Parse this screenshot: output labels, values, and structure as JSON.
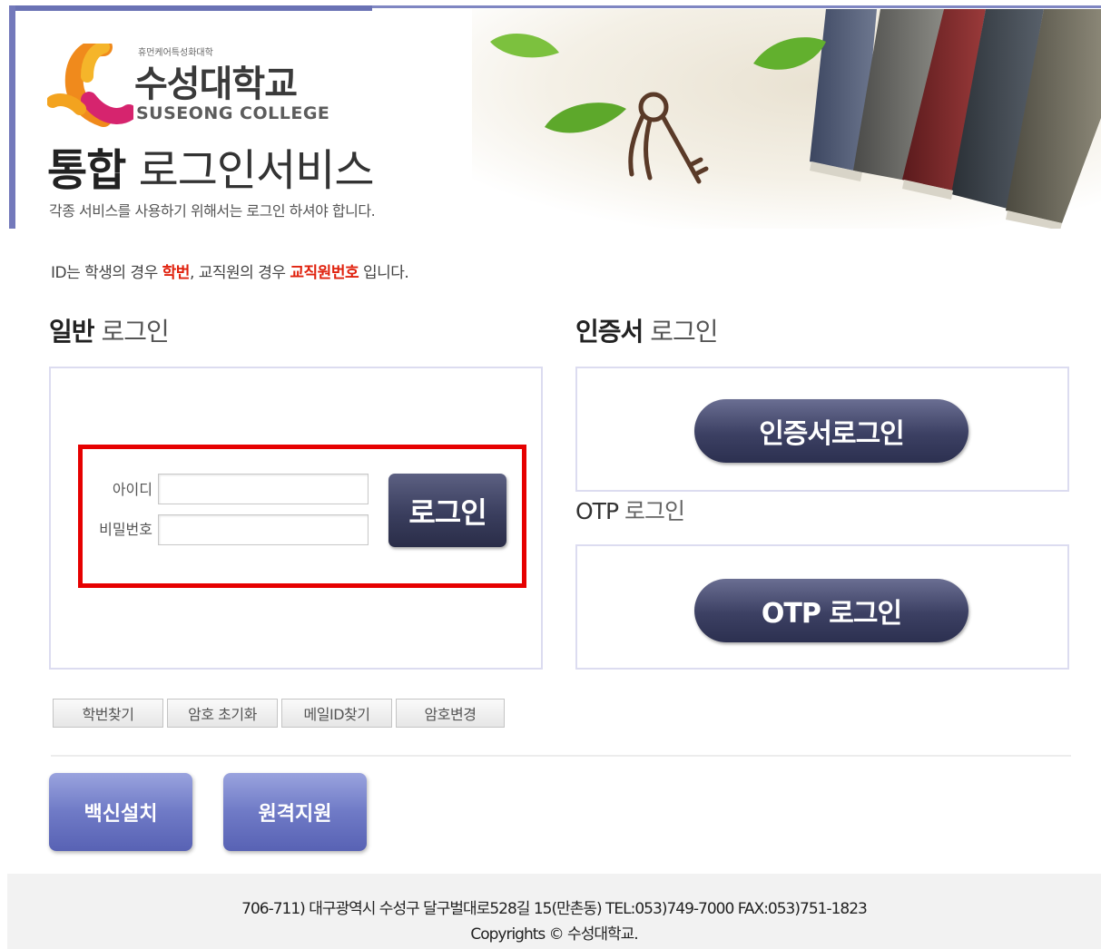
{
  "header": {
    "logo_small": "휴먼케어특성화대학",
    "logo_ko": "수성대학교",
    "logo_en": "SUSEONG COLLEGE",
    "title_bold": "통합",
    "title_light": "로그인서비스",
    "subtitle": "각종 서비스를 사용하기 위해서는 로그인 하셔야 합니다."
  },
  "notice": {
    "part1": "ID는 학생의 경우 ",
    "hl1": "학번",
    "part2": ", 교직원의 경우 ",
    "hl2": "교직원번호",
    "part3": " 입니다."
  },
  "general_login": {
    "title_bold": "일반",
    "title_light": "로그인",
    "id_label": "아이디",
    "id_value": "",
    "pw_label": "비밀번호",
    "pw_value": "",
    "button": "로그인"
  },
  "cert_login": {
    "title_bold": "인증서",
    "title_light": "로그인",
    "button": "인증서로그인"
  },
  "otp_login": {
    "title_bold": "OTP",
    "title_light": "로그인",
    "button": "OTP 로그인"
  },
  "tabs": [
    "학번찾기",
    "암호 초기화",
    "메일ID찾기",
    "암호변경"
  ],
  "quick_buttons": {
    "vaccine": "백신설치",
    "remote": "원격지원"
  },
  "footer": {
    "address": "706-711) 대구광역시 수성구 달구벌대로528길 15(만촌동) TEL:053)749-7000 FAX:053)751-1823",
    "copyright": "Copyrights © 수성대학교."
  },
  "colors": {
    "accent": "#7379bb",
    "highlight": "#e0220e",
    "button_dark": "#3a3e5e",
    "annotation": "#e60000"
  }
}
